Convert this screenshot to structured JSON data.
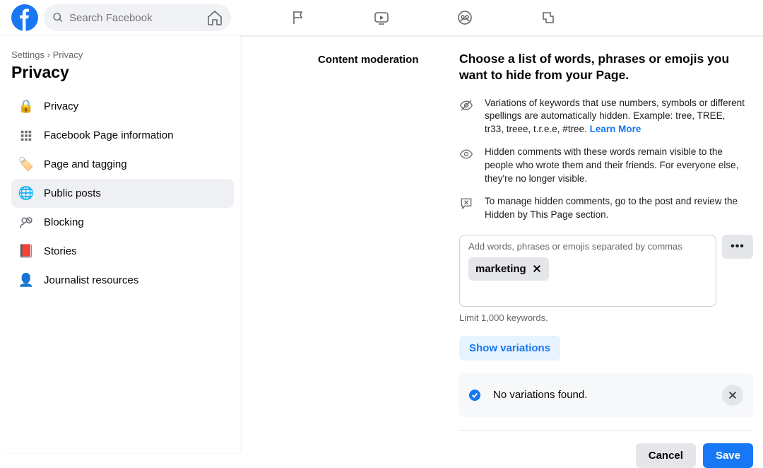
{
  "header": {
    "search_placeholder": "Search Facebook"
  },
  "breadcrumb": {
    "parent": "Settings",
    "sep": "›",
    "current": "Privacy"
  },
  "page_title": "Privacy",
  "sidebar": {
    "items": [
      {
        "label": "Privacy",
        "icon": "🔒"
      },
      {
        "label": "Facebook Page information",
        "icon": ""
      },
      {
        "label": "Page and tagging",
        "icon": "🏷️"
      },
      {
        "label": "Public posts",
        "icon": "🌐"
      },
      {
        "label": "Blocking",
        "icon": "🚫"
      },
      {
        "label": "Stories",
        "icon": "📕"
      },
      {
        "label": "Journalist resources",
        "icon": "👤"
      }
    ],
    "active_index": 3
  },
  "section_label": "Content moderation",
  "heading": "Choose a list of words, phrases or emojis you want to hide from your Page.",
  "info1": "Variations of keywords that use numbers, symbols or different spellings are automatically hidden. Example: tree, TREE, tr33, treee, t.r.e.e, #tree. ",
  "learn_more": "Learn More",
  "info2": "Hidden comments with these words remain visible to the people who wrote them and their friends. For everyone else, they're no longer visible.",
  "info3": "To manage hidden comments, go to the post and review the Hidden by This Page section.",
  "chipbox": {
    "placeholder": "Add words, phrases or emojis separated by commas",
    "chips": [
      {
        "label": "marketing"
      }
    ]
  },
  "limit_text": "Limit 1,000 keywords.",
  "show_variations_label": "Show variations",
  "alert": {
    "text": "No variations found."
  },
  "buttons": {
    "cancel": "Cancel",
    "save": "Save"
  },
  "more_dots": "•••"
}
